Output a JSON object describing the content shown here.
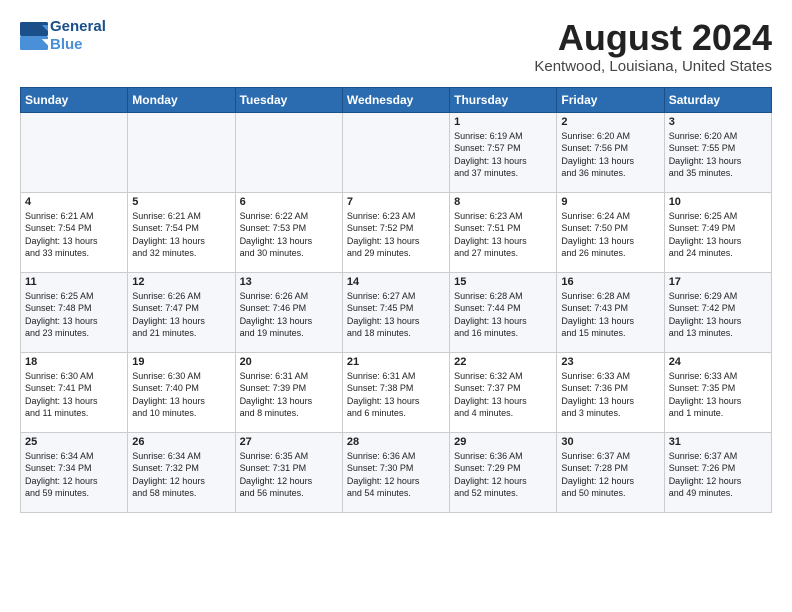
{
  "header": {
    "logo_line1": "General",
    "logo_line2": "Blue",
    "month_title": "August 2024",
    "location": "Kentwood, Louisiana, United States"
  },
  "days_of_week": [
    "Sunday",
    "Monday",
    "Tuesday",
    "Wednesday",
    "Thursday",
    "Friday",
    "Saturday"
  ],
  "weeks": [
    [
      {
        "day": "",
        "info": ""
      },
      {
        "day": "",
        "info": ""
      },
      {
        "day": "",
        "info": ""
      },
      {
        "day": "",
        "info": ""
      },
      {
        "day": "1",
        "info": "Sunrise: 6:19 AM\nSunset: 7:57 PM\nDaylight: 13 hours\nand 37 minutes."
      },
      {
        "day": "2",
        "info": "Sunrise: 6:20 AM\nSunset: 7:56 PM\nDaylight: 13 hours\nand 36 minutes."
      },
      {
        "day": "3",
        "info": "Sunrise: 6:20 AM\nSunset: 7:55 PM\nDaylight: 13 hours\nand 35 minutes."
      }
    ],
    [
      {
        "day": "4",
        "info": "Sunrise: 6:21 AM\nSunset: 7:54 PM\nDaylight: 13 hours\nand 33 minutes."
      },
      {
        "day": "5",
        "info": "Sunrise: 6:21 AM\nSunset: 7:54 PM\nDaylight: 13 hours\nand 32 minutes."
      },
      {
        "day": "6",
        "info": "Sunrise: 6:22 AM\nSunset: 7:53 PM\nDaylight: 13 hours\nand 30 minutes."
      },
      {
        "day": "7",
        "info": "Sunrise: 6:23 AM\nSunset: 7:52 PM\nDaylight: 13 hours\nand 29 minutes."
      },
      {
        "day": "8",
        "info": "Sunrise: 6:23 AM\nSunset: 7:51 PM\nDaylight: 13 hours\nand 27 minutes."
      },
      {
        "day": "9",
        "info": "Sunrise: 6:24 AM\nSunset: 7:50 PM\nDaylight: 13 hours\nand 26 minutes."
      },
      {
        "day": "10",
        "info": "Sunrise: 6:25 AM\nSunset: 7:49 PM\nDaylight: 13 hours\nand 24 minutes."
      }
    ],
    [
      {
        "day": "11",
        "info": "Sunrise: 6:25 AM\nSunset: 7:48 PM\nDaylight: 13 hours\nand 23 minutes."
      },
      {
        "day": "12",
        "info": "Sunrise: 6:26 AM\nSunset: 7:47 PM\nDaylight: 13 hours\nand 21 minutes."
      },
      {
        "day": "13",
        "info": "Sunrise: 6:26 AM\nSunset: 7:46 PM\nDaylight: 13 hours\nand 19 minutes."
      },
      {
        "day": "14",
        "info": "Sunrise: 6:27 AM\nSunset: 7:45 PM\nDaylight: 13 hours\nand 18 minutes."
      },
      {
        "day": "15",
        "info": "Sunrise: 6:28 AM\nSunset: 7:44 PM\nDaylight: 13 hours\nand 16 minutes."
      },
      {
        "day": "16",
        "info": "Sunrise: 6:28 AM\nSunset: 7:43 PM\nDaylight: 13 hours\nand 15 minutes."
      },
      {
        "day": "17",
        "info": "Sunrise: 6:29 AM\nSunset: 7:42 PM\nDaylight: 13 hours\nand 13 minutes."
      }
    ],
    [
      {
        "day": "18",
        "info": "Sunrise: 6:30 AM\nSunset: 7:41 PM\nDaylight: 13 hours\nand 11 minutes."
      },
      {
        "day": "19",
        "info": "Sunrise: 6:30 AM\nSunset: 7:40 PM\nDaylight: 13 hours\nand 10 minutes."
      },
      {
        "day": "20",
        "info": "Sunrise: 6:31 AM\nSunset: 7:39 PM\nDaylight: 13 hours\nand 8 minutes."
      },
      {
        "day": "21",
        "info": "Sunrise: 6:31 AM\nSunset: 7:38 PM\nDaylight: 13 hours\nand 6 minutes."
      },
      {
        "day": "22",
        "info": "Sunrise: 6:32 AM\nSunset: 7:37 PM\nDaylight: 13 hours\nand 4 minutes."
      },
      {
        "day": "23",
        "info": "Sunrise: 6:33 AM\nSunset: 7:36 PM\nDaylight: 13 hours\nand 3 minutes."
      },
      {
        "day": "24",
        "info": "Sunrise: 6:33 AM\nSunset: 7:35 PM\nDaylight: 13 hours\nand 1 minute."
      }
    ],
    [
      {
        "day": "25",
        "info": "Sunrise: 6:34 AM\nSunset: 7:34 PM\nDaylight: 12 hours\nand 59 minutes."
      },
      {
        "day": "26",
        "info": "Sunrise: 6:34 AM\nSunset: 7:32 PM\nDaylight: 12 hours\nand 58 minutes."
      },
      {
        "day": "27",
        "info": "Sunrise: 6:35 AM\nSunset: 7:31 PM\nDaylight: 12 hours\nand 56 minutes."
      },
      {
        "day": "28",
        "info": "Sunrise: 6:36 AM\nSunset: 7:30 PM\nDaylight: 12 hours\nand 54 minutes."
      },
      {
        "day": "29",
        "info": "Sunrise: 6:36 AM\nSunset: 7:29 PM\nDaylight: 12 hours\nand 52 minutes."
      },
      {
        "day": "30",
        "info": "Sunrise: 6:37 AM\nSunset: 7:28 PM\nDaylight: 12 hours\nand 50 minutes."
      },
      {
        "day": "31",
        "info": "Sunrise: 6:37 AM\nSunset: 7:26 PM\nDaylight: 12 hours\nand 49 minutes."
      }
    ]
  ]
}
